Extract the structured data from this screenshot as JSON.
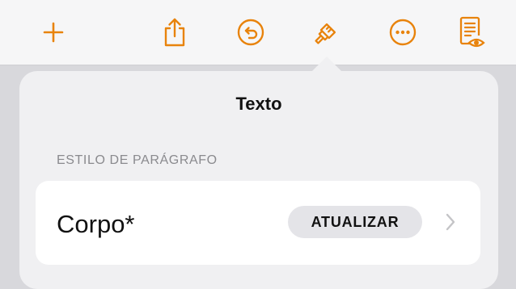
{
  "toolbar": {
    "buttons": [
      {
        "name": "add",
        "icon": "plus-icon"
      },
      {
        "name": "share",
        "icon": "share-icon"
      },
      {
        "name": "undo",
        "icon": "undo-icon"
      },
      {
        "name": "format",
        "icon": "paintbrush-icon"
      },
      {
        "name": "more",
        "icon": "ellipsis-icon"
      },
      {
        "name": "reader-view",
        "icon": "document-eye-icon"
      }
    ]
  },
  "popover": {
    "title": "Texto",
    "section_label": "ESTILO DE PARÁGRAFO",
    "style_name": "Corpo*",
    "update_label": "ATUALIZAR",
    "chevron_icon": "chevron-right-icon"
  },
  "colors": {
    "accent": "#e8830c",
    "toolbar_bg": "#f6f6f7",
    "popover_bg": "#f0f0f2",
    "card_bg": "#ffffff",
    "secondary_text": "#8a8a8e",
    "chevron": "#c4c4c7"
  }
}
